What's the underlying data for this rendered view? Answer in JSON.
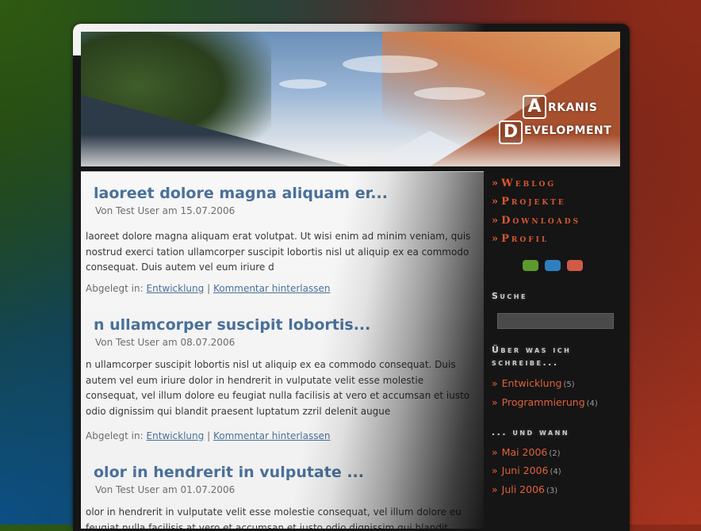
{
  "logo": {
    "letter_a": "A",
    "letter_d": "D",
    "rest_a": "RKANIS",
    "rest_d": "EVELOPMENT"
  },
  "posts": [
    {
      "title": "laoreet dolore magna aliquam er...",
      "meta": "Von Test User am 15.07.2006",
      "body": "laoreet dolore magna aliquam erat volutpat. Ut wisi enim ad minim veniam, quis nostrud exerci tation ullamcorper suscipit lobortis nisl ut aliquip ex ea commodo consequat. Duis autem vel eum iriure d",
      "filed_label": "Abgelegt in:",
      "category": "Entwicklung",
      "separator": "|",
      "comment_link": "Kommentar hinterlassen"
    },
    {
      "title": "n ullamcorper suscipit lobortis...",
      "meta": "Von Test User am 08.07.2006",
      "body": "n ullamcorper suscipit lobortis nisl ut aliquip ex ea commodo consequat. Duis autem vel eum iriure dolor in hendrerit in vulputate velit esse molestie consequat, vel illum dolore eu feugiat nulla facilisis at vero et accumsan et iusto odio dignissim qui blandit praesent luptatum zzril delenit augue",
      "filed_label": "Abgelegt in:",
      "category": "Entwicklung",
      "separator": "|",
      "comment_link": "Kommentar hinterlassen"
    },
    {
      "title": "olor in hendrerit in vulputate ...",
      "meta": "Von Test User am 01.07.2006",
      "body": "olor in hendrerit in vulputate velit esse molestie consequat, vel illum dolore eu feugiat nulla facilisis at vero et accumsan et iusto odio dignissim qui blandit"
    }
  ],
  "sidebar": {
    "arrow": "»",
    "nav": [
      "Weblog",
      "Projekte",
      "Downloads",
      "Profil"
    ],
    "dots": [
      "#5d9a2e",
      "#2f7fc0",
      "#cf5a48"
    ],
    "search_heading": "Suche",
    "topics_heading": "Über was ich schreibe...",
    "topics": [
      {
        "label": "Entwicklung",
        "count": "(5)"
      },
      {
        "label": "Programmierung",
        "count": "(4)"
      }
    ],
    "archive_heading": "... und wann",
    "archive": [
      {
        "label": "Mai 2006",
        "count": "(2)"
      },
      {
        "label": "Juni 2006",
        "count": "(4)"
      },
      {
        "label": "Juli 2006",
        "count": "(3)"
      }
    ]
  },
  "colors": {
    "title": "#4a7099",
    "accent": "#d9572f",
    "link": "#e0613a"
  }
}
